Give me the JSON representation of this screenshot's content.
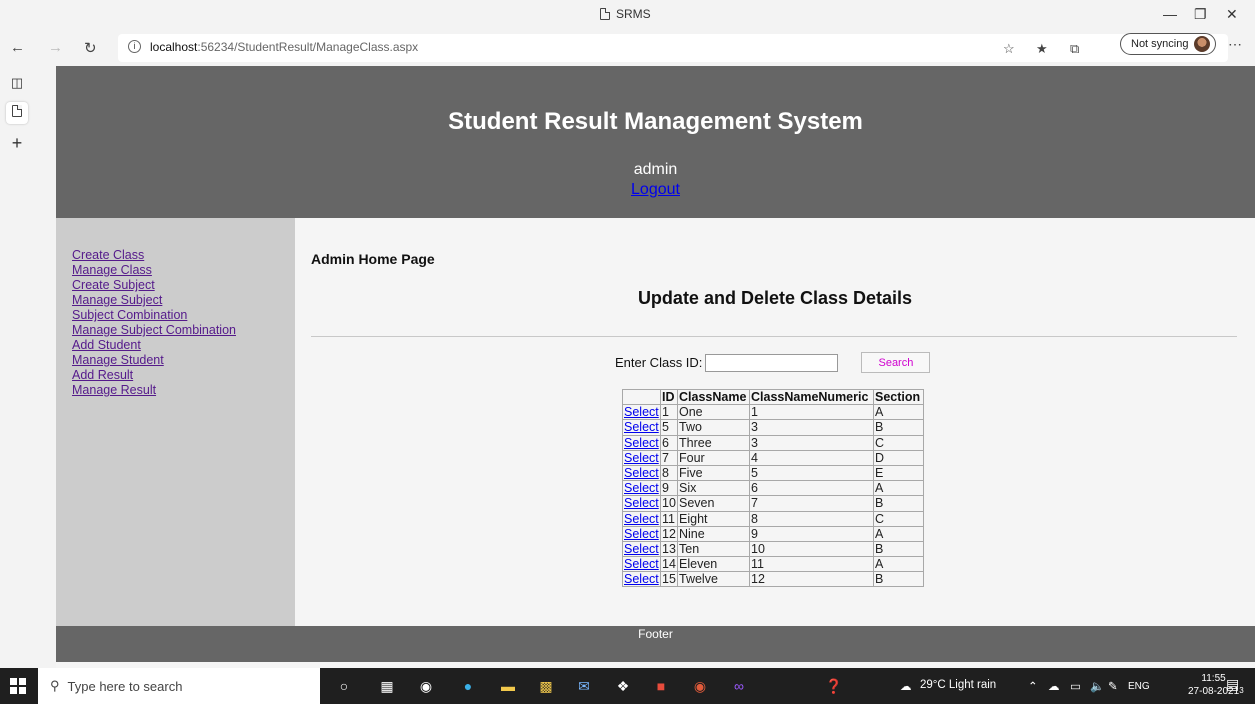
{
  "browser": {
    "tab_title": "SRMS",
    "url_host": "localhost",
    "url_path": ":56234/StudentResult/ManageClass.aspx",
    "sync_label": "Not syncing"
  },
  "header": {
    "title": "Student Result Management System",
    "user": "admin",
    "logout": "Logout"
  },
  "sidebar": {
    "items": [
      "Create Class",
      "Manage Class",
      "Create Subject",
      "Manage Subject",
      "Subject Combination",
      "Manage Subject Combination",
      "Add Student",
      "Manage Student",
      "Add Result",
      "Manage Result"
    ]
  },
  "main": {
    "page_heading": "Admin Home Page",
    "section_title": "Update and Delete Class Details",
    "search_label": "Enter Class ID:",
    "search_value": "",
    "search_button": "Search",
    "table": {
      "columns": [
        "",
        "ID",
        "ClassName",
        "ClassNameNumeric",
        "Section"
      ],
      "select_label": "Select",
      "rows": [
        [
          "1",
          "One",
          "1",
          "A"
        ],
        [
          "5",
          "Two",
          "3",
          "B"
        ],
        [
          "6",
          "Three",
          "3",
          "C"
        ],
        [
          "7",
          "Four",
          "4",
          "D"
        ],
        [
          "8",
          "Five",
          "5",
          "E"
        ],
        [
          "9",
          "Six",
          "6",
          "A"
        ],
        [
          "10",
          "Seven",
          "7",
          "B"
        ],
        [
          "11",
          "Eight",
          "8",
          "C"
        ],
        [
          "12",
          "Nine",
          "9",
          "A"
        ],
        [
          "13",
          "Ten",
          "10",
          "B"
        ],
        [
          "14",
          "Eleven",
          "11",
          "A"
        ],
        [
          "15",
          "Twelve",
          "12",
          "B"
        ]
      ]
    }
  },
  "footer": {
    "text": "Footer"
  },
  "taskbar": {
    "search_placeholder": "Type here to search",
    "weather": "29°C  Light rain",
    "language": "ENG",
    "time": "11:55",
    "date": "27-08-2021",
    "notification_count": "3"
  },
  "colors": {
    "header_bg": "#666666",
    "sidebar_bg": "#cccccc",
    "link": "#0000ee",
    "visited_link": "#551a8b",
    "search_text": "#d000d0"
  }
}
